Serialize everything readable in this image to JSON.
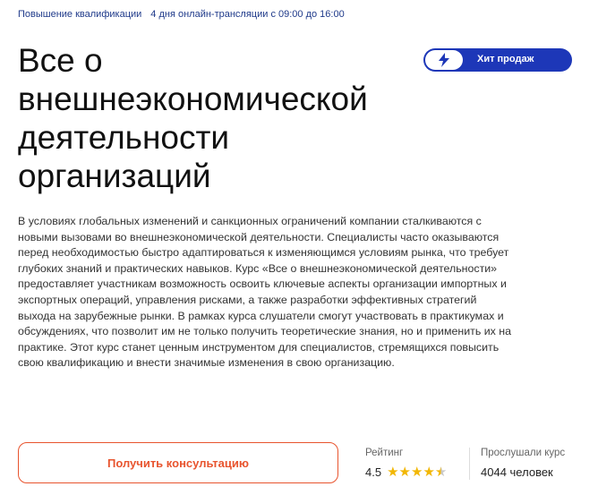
{
  "header": {
    "tags": [
      "Повышение квалификации",
      "4 дня онлайн-трансляции с 09:00 до 16:00"
    ]
  },
  "course": {
    "title": "Все о внешнеэкономической деятельности организаций",
    "badge": {
      "label": "Хит продаж",
      "icon": "lightning-icon"
    },
    "description": "В условиях глобальных изменений и санкционных ограничений компании сталкиваются с новыми вызовами во внешнеэкономической деятельности. Специалисты часто оказываются перед необходимостью быстро адаптироваться к изменяющимся условиям рынка, что требует глубоких знаний и практических навыков. Курс «Все о внешнеэкономической деятельности» предоставляет участникам возможность освоить ключевые аспекты организации импортных и экспортных операций, управления рисками, а также разработки эффективных стратегий выхода на зарубежные рынки. В рамках курса слушатели смогут участвовать в практикумах и обсуждениях, что позволит им не только получить теоретические знания, но и применить их на практике. Этот курс станет ценным инструментом для специалистов, стремящихся повысить свою квалификацию и внести значимые изменения в свою организацию."
  },
  "cta": {
    "label": "Получить консультацию"
  },
  "rating": {
    "label": "Рейтинг",
    "value": "4.5",
    "stars_filled": 4.5,
    "stars_max": 5
  },
  "views": {
    "label": "Прослушали курс",
    "value": "4044 человек"
  },
  "colors": {
    "accent": "#e8542e",
    "brand": "#1d37b8",
    "star": "#f2b705"
  }
}
